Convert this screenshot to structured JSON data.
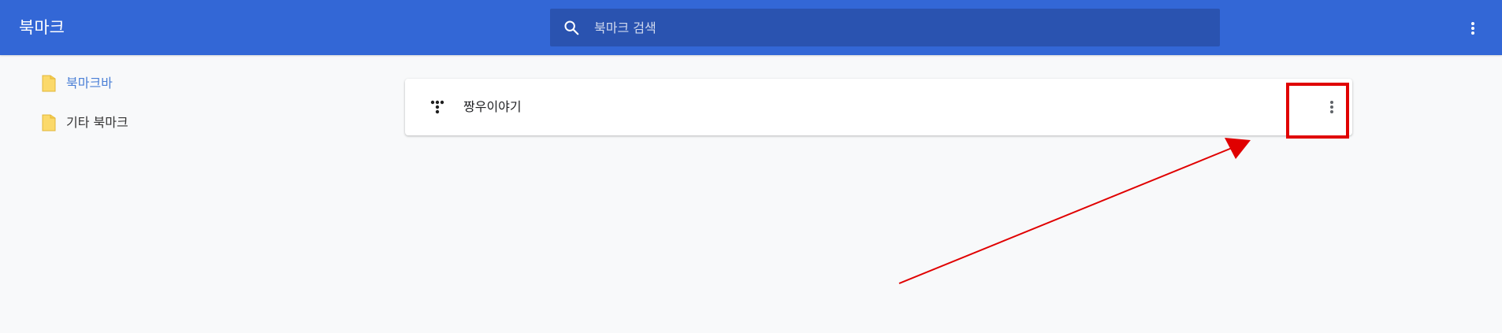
{
  "header": {
    "title": "북마크",
    "menu_icon": "more-vert-icon"
  },
  "search": {
    "placeholder": "북마크 검색",
    "icon": "search-icon"
  },
  "sidebar": {
    "items": [
      {
        "label": "북마크바",
        "icon": "folder-icon",
        "selected": true
      },
      {
        "label": "기타 북마크",
        "icon": "folder-icon",
        "selected": false
      }
    ]
  },
  "bookmarks": [
    {
      "title": "짱우이야기",
      "favicon": "tistory-favicon",
      "menu_icon": "more-vert-icon"
    }
  ],
  "colors": {
    "header": "#3367d6",
    "search_box": "#2a53b0",
    "background": "#f8f9fa",
    "folder": "#fbd96a",
    "annotation": "#e00000"
  }
}
